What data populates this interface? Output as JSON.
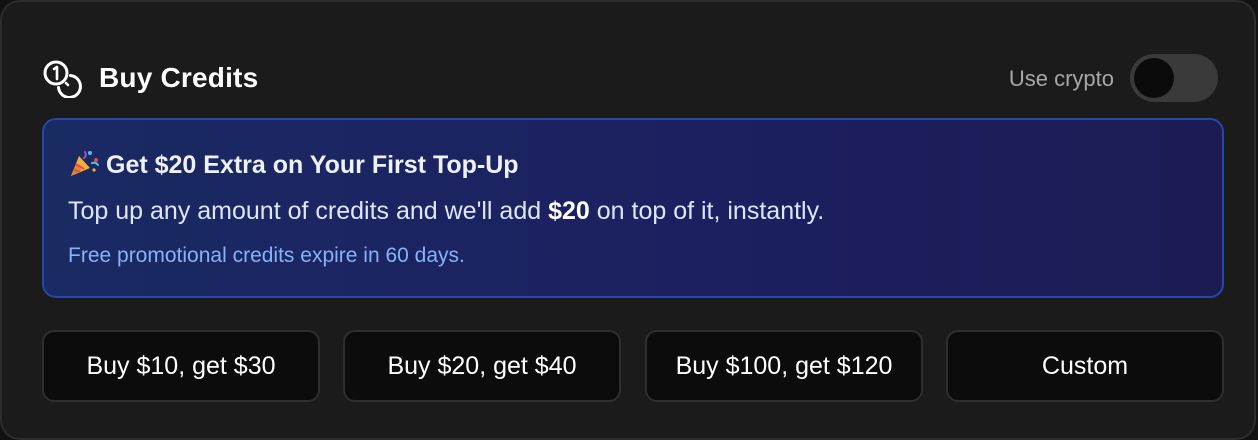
{
  "header": {
    "title": "Buy Credits",
    "icon": "coins-icon",
    "crypto_label": "Use crypto",
    "crypto_enabled": false
  },
  "promo": {
    "icon": "party-popper-icon",
    "heading": "Get $20 Extra on Your First Top-Up",
    "body_before": "Top up any amount of credits and we'll add ",
    "body_bold": "$20",
    "body_after": " on top of it, instantly.",
    "note": "Free promotional credits expire in 60 days."
  },
  "options": [
    {
      "label": "Buy $10, get $30"
    },
    {
      "label": "Buy $20, get $40"
    },
    {
      "label": "Buy $100, get $120"
    },
    {
      "label": "Custom"
    }
  ],
  "colors": {
    "card_bg": "#1b1b1b",
    "promo_border": "#2846a8",
    "promo_note": "#86b2f7",
    "button_bg": "#0c0c0c"
  }
}
